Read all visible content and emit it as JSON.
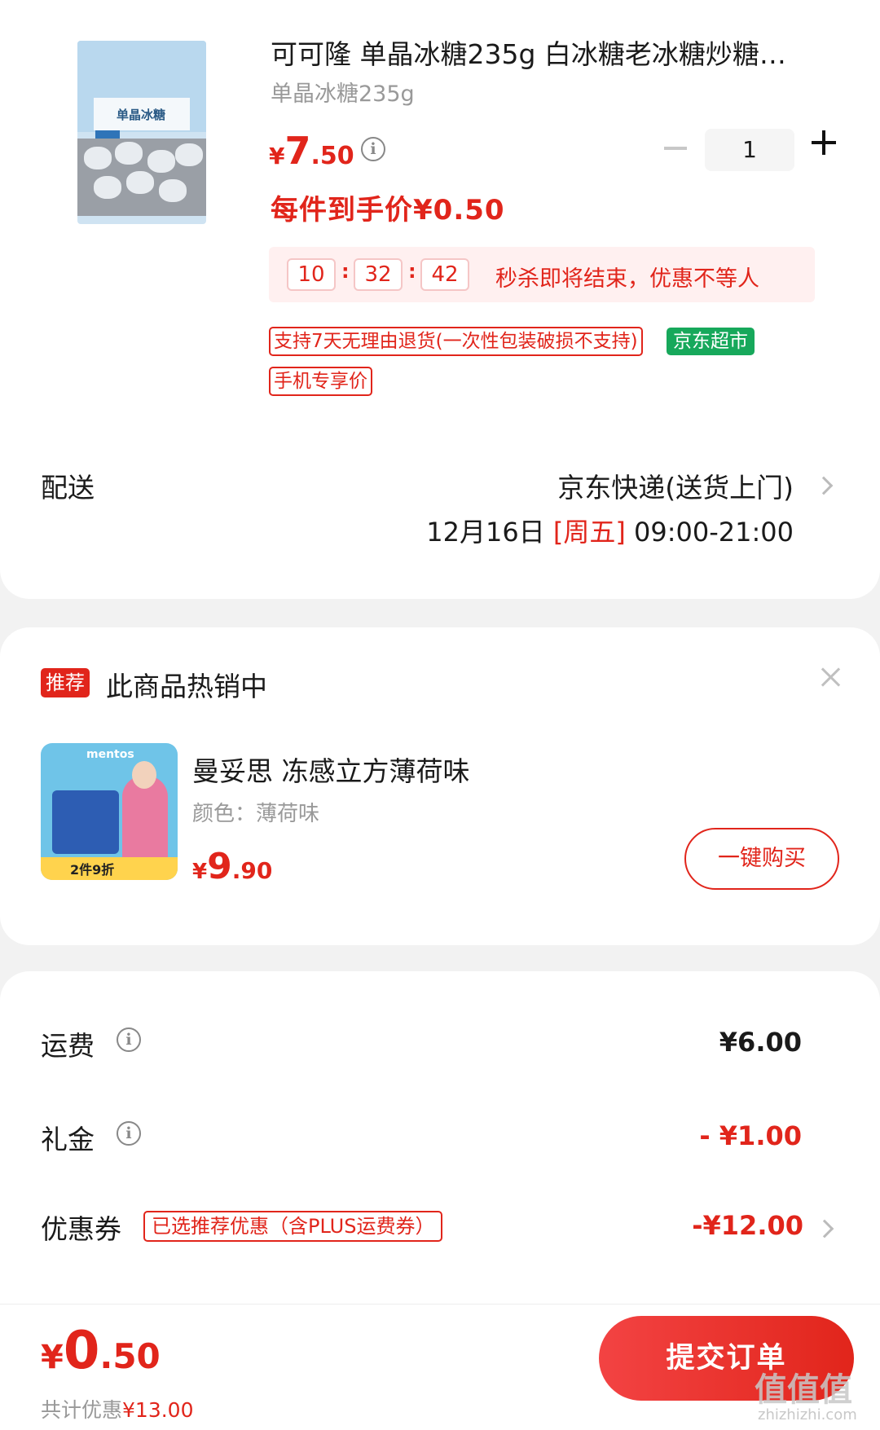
{
  "product": {
    "title": "可可隆 单晶冰糖235g 白冰糖老冰糖炒糖…",
    "spec": "单晶冰糖235g",
    "price_yen": "¥",
    "price_int": "7",
    "price_dec": ".50",
    "quantity": "1",
    "net_price": "每件到手价¥0.50",
    "thumb_label": "单晶冰糖"
  },
  "countdown": {
    "hours": "10",
    "minutes": "32",
    "seconds": "42",
    "message": "秒杀即将结束，优惠不等人"
  },
  "tags": {
    "return_policy": "支持7天无理由退货(一次性包装破损不支持)",
    "store": "京东超市",
    "mobile_price": "手机专享价"
  },
  "delivery": {
    "label": "配送",
    "method": "京东快递(送货上门)",
    "date": "12月16日",
    "weekday": "[周五]",
    "time": "09:00-21:00"
  },
  "recommendation": {
    "badge": "推荐",
    "title": "此商品热销中",
    "name": "曼妥思 冻感立方薄荷味",
    "spec": "颜色：薄荷味",
    "price_yen": "¥",
    "price_int": "9",
    "price_dec": ".90",
    "buy_label": "一键购买",
    "img_brand": "mentos",
    "img_promo": "2件9折"
  },
  "fees": {
    "shipping_label": "运费",
    "shipping_value": "¥6.00",
    "gift_label": "礼金",
    "gift_value": "- ¥1.00",
    "coupon_label": "优惠券",
    "coupon_tag": "已选推荐优惠（含PLUS运费券）",
    "coupon_value": "-¥12.00"
  },
  "footer": {
    "total_yen": "¥",
    "total_int": "0",
    "total_dec": ".50",
    "saved_label": "共计优惠",
    "saved_value": "¥13.00",
    "submit_label": "提交订单",
    "watermark": "值值值",
    "watermark_url": "zhizhizhi.com"
  },
  "colors": {
    "accent": "#e1251b",
    "green": "#17a85b",
    "background": "#f2f2f2"
  }
}
